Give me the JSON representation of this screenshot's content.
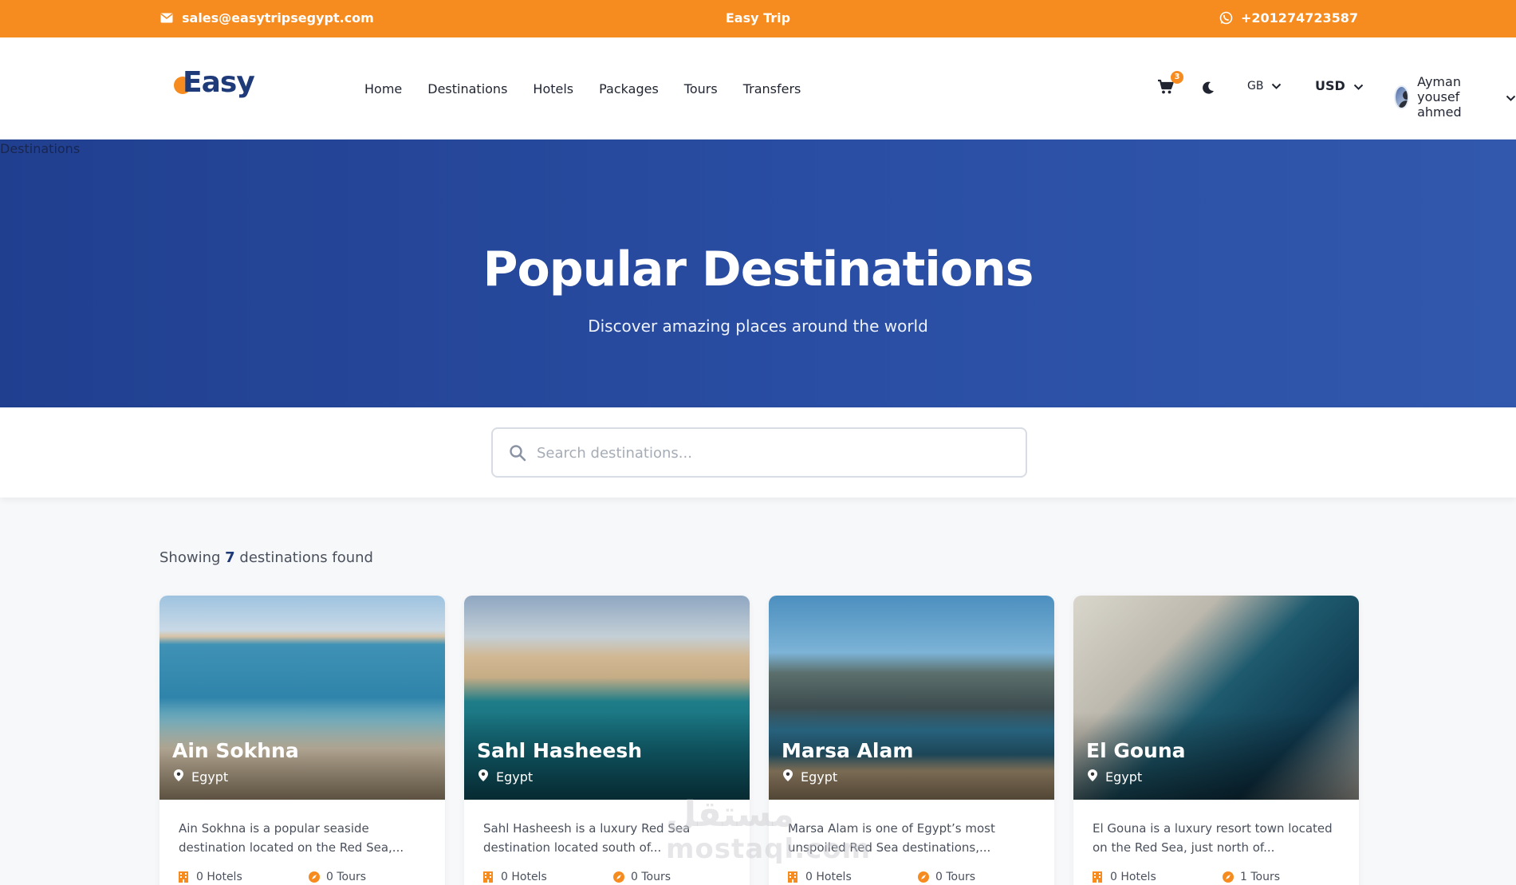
{
  "topbar": {
    "email": "sales@easytripsegypt.com",
    "brand": "Easy Trip",
    "phone": "+201274723587",
    "bg_color": "#f68b1f"
  },
  "header": {
    "logo_text": "Easy",
    "nav": [
      "Home",
      "Destinations",
      "Hotels",
      "Packages",
      "Tours",
      "Transfers"
    ],
    "cart_count": "3",
    "language": "GB",
    "currency": "USD",
    "user_name": "Ayman yousef ahmed"
  },
  "hero": {
    "alt_text": "Destinations",
    "title": "Popular Destinations",
    "subtitle": "Discover amazing places around the world"
  },
  "search": {
    "placeholder": "Search destinations..."
  },
  "results": {
    "prefix": "Showing",
    "count": "7",
    "suffix": "destinations found"
  },
  "cards": [
    {
      "title": "Ain Sokhna",
      "location": "Egypt",
      "description": "Ain Sokhna is a popular seaside destination located on the Red Sea,...",
      "hotels": "0 Hotels",
      "tours": "0 Tours"
    },
    {
      "title": "Sahl Hasheesh",
      "location": "Egypt",
      "description": "Sahl Hasheesh is a luxury Red Sea destination located south of...",
      "hotels": "0 Hotels",
      "tours": "0 Tours"
    },
    {
      "title": "Marsa Alam",
      "location": "Egypt",
      "description": "Marsa Alam is one of Egypt’s most unspoiled Red Sea destinations,...",
      "hotels": "0 Hotels",
      "tours": "0 Tours"
    },
    {
      "title": "El Gouna",
      "location": "Egypt",
      "description": "El Gouna is a luxury resort town located on the Red Sea, just north of...",
      "hotels": "0 Hotels",
      "tours": "1 Tours"
    }
  ],
  "watermark": {
    "line1": "مستقل",
    "line2": "mostaql.com"
  },
  "icons": [
    "envelope-icon",
    "whatsapp-icon",
    "cart-icon",
    "moon-icon",
    "chevron-down-icon",
    "search-icon",
    "location-pin-icon",
    "hotel-icon",
    "compass-icon"
  ],
  "colors": {
    "accent": "#f68b1f",
    "primary": "#1f3a78",
    "hero_start": "#213f8f",
    "hero_end": "#3158ad"
  }
}
